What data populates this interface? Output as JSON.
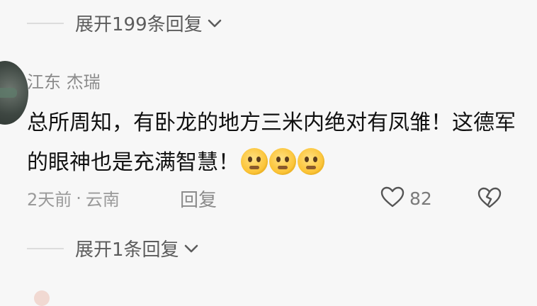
{
  "top_expand": {
    "label": "展开199条回复"
  },
  "comment": {
    "username": "江东 杰瑞",
    "text": "总所周知，有卧龙的地方三米内绝对有凤雏！这德军的眼神也是充满智慧！",
    "emojis": [
      "pleading-face",
      "pleading-face",
      "pleading-face"
    ],
    "time": "2天前",
    "separator": "·",
    "location": "云南",
    "reply_label": "回复",
    "like_count": "82"
  },
  "bottom_expand": {
    "label": "展开1条回复"
  },
  "colors": {
    "background": "#f7f7f7",
    "text": "#111111",
    "muted": "#8b8b8b"
  }
}
